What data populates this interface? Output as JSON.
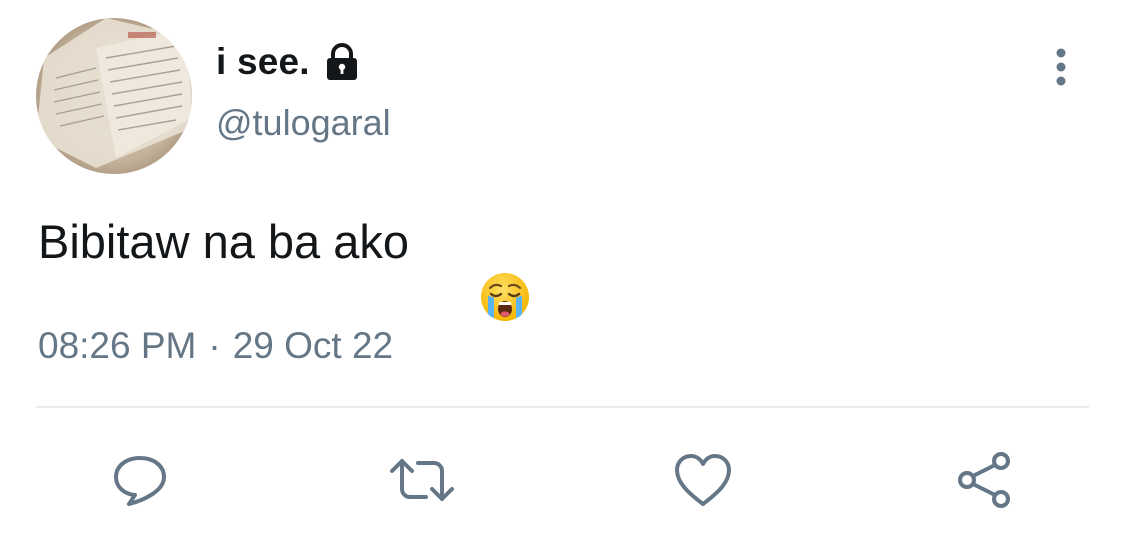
{
  "author": {
    "display_name": "i see.",
    "handle": "@tulogaral",
    "avatar_icon": "notebook-photo-avatar",
    "protected_icon": "lock-icon"
  },
  "tweet": {
    "text": "Bibitaw na ba ako",
    "emoji": "😭",
    "time": "08:26 PM",
    "separator": "·",
    "date": "29 Oct 22"
  },
  "actions": {
    "reply_icon": "reply-icon",
    "retweet_icon": "retweet-icon",
    "like_icon": "heart-icon",
    "share_icon": "share-icon"
  },
  "colors": {
    "text_primary": "#14171a",
    "text_secondary": "#657786",
    "divider": "#e6ecf0",
    "icon": "#657786"
  }
}
